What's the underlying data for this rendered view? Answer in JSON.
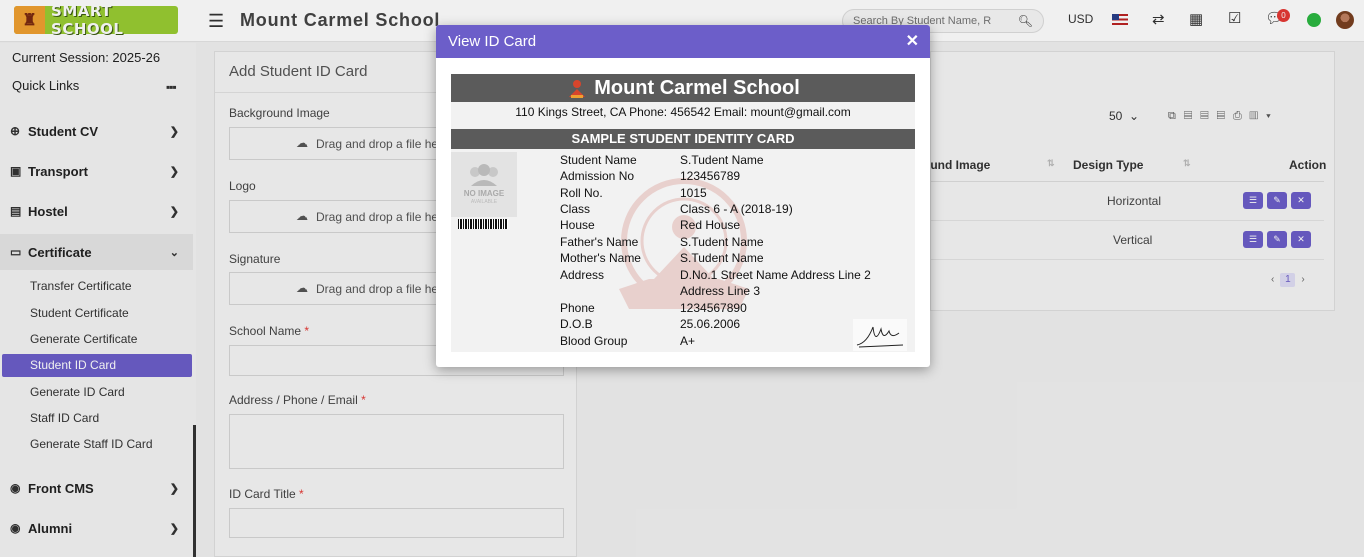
{
  "header": {
    "logo_text": "SMART SCHOOL",
    "school_title": "Mount Carmel School",
    "search_placeholder": "Search By Student Name, R",
    "currency": "USD",
    "notification_count": "0"
  },
  "sidebar": {
    "session": "Current Session: 2025-26",
    "quick_links": "Quick Links",
    "groups": [
      {
        "label": "Student CV"
      },
      {
        "label": "Transport"
      },
      {
        "label": "Hostel"
      },
      {
        "label": "Certificate"
      },
      {
        "label": "Front CMS"
      },
      {
        "label": "Alumni"
      }
    ],
    "certificate_items": [
      "Transfer Certificate",
      "Student Certificate",
      "Generate Certificate",
      "Student ID Card",
      "Generate ID Card",
      "Staff ID Card",
      "Generate Staff ID Card"
    ]
  },
  "form": {
    "title": "Add Student ID Card",
    "background_label": "Background Image",
    "logo_label": "Logo",
    "signature_label": "Signature",
    "drop_text": "Drag and drop a file here or click",
    "school_name_label": "School Name",
    "address_label": "Address / Phone / Email",
    "id_card_title_label": "ID Card Title",
    "required_mark": "*"
  },
  "list": {
    "per_page": "50",
    "col_background": "ound Image",
    "col_design": "Design Type",
    "col_action": "Action",
    "rows": [
      {
        "design": "Horizontal"
      },
      {
        "design": "Vertical"
      }
    ],
    "page": "1",
    "prev": "‹",
    "next": "›"
  },
  "modal": {
    "title": "View ID Card",
    "close": "✕",
    "card": {
      "school": "Mount Carmel School",
      "address": "110 Kings Street, CA Phone: 456542 Email: mount@gmail.com",
      "band": "SAMPLE STUDENT IDENTITY CARD",
      "photo_text": "NO IMAGE",
      "photo_sub": "AVAILABLE",
      "fields": [
        {
          "k": "Student Name",
          "v": "S.Tudent Name"
        },
        {
          "k": "Admission No",
          "v": "123456789"
        },
        {
          "k": "Roll No.",
          "v": "1015"
        },
        {
          "k": "Class",
          "v": "Class 6 - A (2018-19)"
        },
        {
          "k": "House",
          "v": "Red House"
        },
        {
          "k": "Father's Name",
          "v": "S.Tudent Name"
        },
        {
          "k": "Mother's Name",
          "v": "S.Tudent Name"
        },
        {
          "k": "Address",
          "v": "D.No.1 Street Name Address Line 2"
        },
        {
          "k": "",
          "v": "Address Line 3"
        },
        {
          "k": "Phone",
          "v": "1234567890"
        },
        {
          "k": "D.O.B",
          "v": "25.06.2006"
        },
        {
          "k": "Blood Group",
          "v": "A+"
        }
      ]
    }
  }
}
